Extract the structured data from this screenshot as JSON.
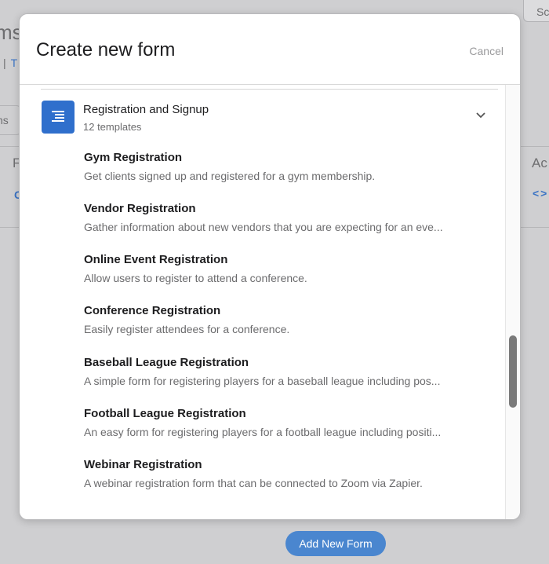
{
  "background": {
    "title": "ms",
    "crumb_sep": "|",
    "crumb_link": "T",
    "tab_label": "ns",
    "col_f": "F",
    "link_c": "C",
    "col_actions": "Ac",
    "code_icon": "<>",
    "top_button": "Sc",
    "add_button": "Add New Form"
  },
  "modal": {
    "title": "Create new form",
    "cancel": "Cancel",
    "category": {
      "title": "Registration and Signup",
      "count": "12 templates"
    },
    "templates": [
      {
        "title": "Gym Registration",
        "desc": "Get clients signed up and registered for a gym membership."
      },
      {
        "title": "Vendor Registration",
        "desc": "Gather information about new vendors that you are expecting for an eve..."
      },
      {
        "title": "Online Event Registration",
        "desc": "Allow users to register to attend a conference."
      },
      {
        "title": "Conference Registration",
        "desc": "Easily register attendees for a conference."
      },
      {
        "title": "Baseball League Registration",
        "desc": "A simple form for registering players for a baseball league including pos..."
      },
      {
        "title": "Football League Registration",
        "desc": "An easy form for registering players for a football league including positi..."
      },
      {
        "title": "Webinar Registration",
        "desc": "A webinar registration form that can be connected to Zoom via Zapier."
      }
    ]
  },
  "colors": {
    "accent": "#2f6fcc",
    "button": "#4a86cf",
    "overlay": "#cfcfd1"
  }
}
